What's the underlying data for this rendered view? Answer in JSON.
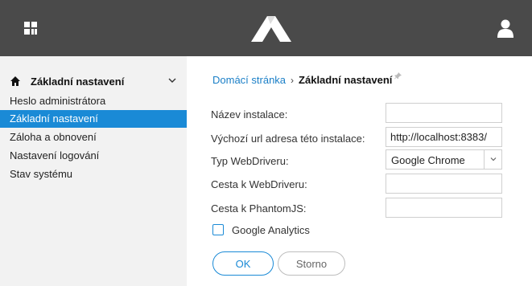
{
  "colors": {
    "topbar": "#4a4a4a",
    "accent": "#1a8ad6",
    "link": "#1a7fc7"
  },
  "header": {
    "left_icon": "grid-icon",
    "logo": "logo-mark",
    "right_icon": "user-icon"
  },
  "sidebar": {
    "section_icon": "home-icon",
    "section_title": "Základní nastavení",
    "items": [
      {
        "label": "Heslo administrátora",
        "active": false
      },
      {
        "label": "Základní nastavení",
        "active": true
      },
      {
        "label": "Záloha a obnovení",
        "active": false
      },
      {
        "label": "Nastavení logování",
        "active": false
      },
      {
        "label": "Stav systému",
        "active": false
      }
    ]
  },
  "breadcrumb": {
    "home": "Domácí stránka",
    "separator": "›",
    "current": "Základní nastavení",
    "pin_icon": "pin-icon"
  },
  "form": {
    "installation_name": {
      "label": "Název instalace:",
      "value": ""
    },
    "default_url": {
      "label": "Výchozí url adresa této instalace:",
      "value": "http://localhost:8383/"
    },
    "webdriver_type": {
      "label": "Typ WebDriveru:",
      "value": "Google Chrome"
    },
    "webdriver_path": {
      "label": "Cesta k WebDriveru:",
      "value": ""
    },
    "phantomjs_path": {
      "label": "Cesta k PhantomJS:",
      "value": ""
    },
    "google_analytics": {
      "label": "Google Analytics",
      "checked": false
    }
  },
  "buttons": {
    "ok": "OK",
    "cancel": "Storno"
  }
}
